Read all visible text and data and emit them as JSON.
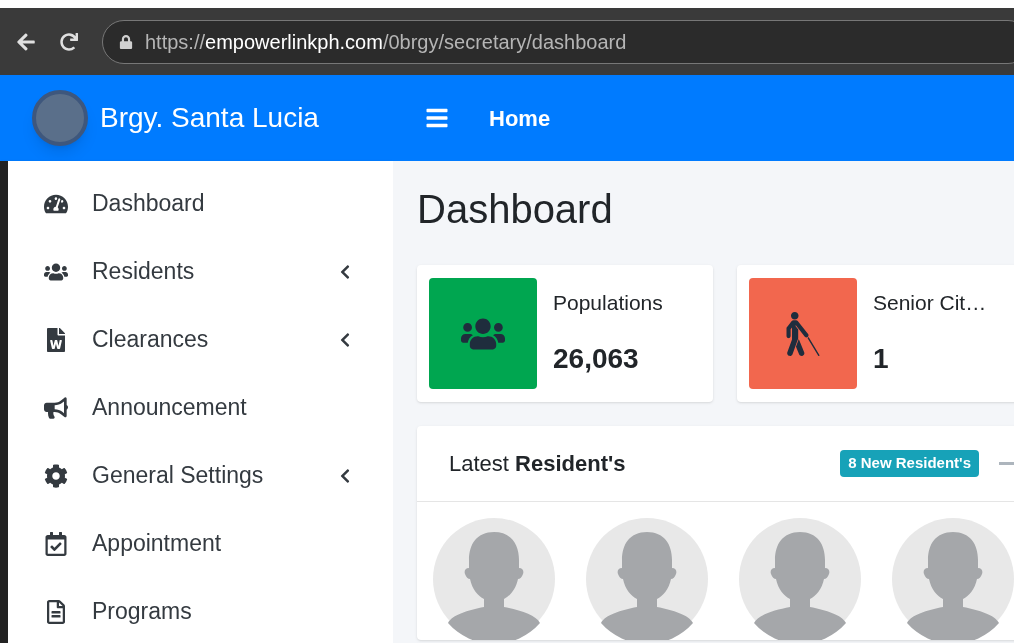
{
  "browser": {
    "url_scheme": "https://",
    "url_domain": "empowerlinkph.com",
    "url_path": "/0brgy/secretary/dashboard"
  },
  "navbar": {
    "brand": "Brgy. Santa Lucia",
    "link": "Home"
  },
  "sidebar": {
    "items": [
      {
        "label": "Dashboard",
        "has_submenu": false
      },
      {
        "label": "Residents",
        "has_submenu": true
      },
      {
        "label": "Clearances",
        "has_submenu": true
      },
      {
        "label": "Announcement",
        "has_submenu": false
      },
      {
        "label": "General Settings",
        "has_submenu": true
      },
      {
        "label": "Appointment",
        "has_submenu": false
      },
      {
        "label": "Programs",
        "has_submenu": false
      }
    ]
  },
  "page_title": "Dashboard",
  "stats": [
    {
      "color": "#00a650",
      "label": "Populations",
      "value": "26,063"
    },
    {
      "color": "#f2674e",
      "label": "Senior Cit…",
      "value": "1"
    }
  ],
  "latest": {
    "title": "Latest **Resident's**",
    "badge": "8 New Resident's"
  }
}
